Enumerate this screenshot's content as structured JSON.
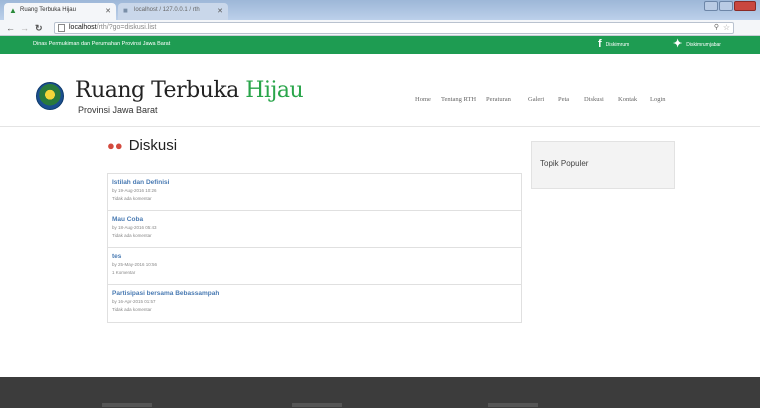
{
  "browser": {
    "active_tab_title": "Ruang Terbuka Hijau",
    "inactive_tab_title": "localhost / 127.0.0.1 / rth",
    "url_host": "localhost",
    "url_path": "/rth/?go=diskusi.list"
  },
  "topbar": {
    "agency": "Dinas Permukiman dan Perumahan Provinsi Jawa Barat",
    "facebook": "Diskimrum",
    "twitter": "Diskimrumjabar"
  },
  "header": {
    "brand_main": "Ruang Terbuka ",
    "brand_accent": "Hijau",
    "brand_sub": "Provinsi Jawa Barat"
  },
  "menu": [
    "Home",
    "Tentang RTH",
    "Peraturan",
    "Galeri",
    "Peta",
    "Diskusi",
    "Kontak",
    "Login"
  ],
  "page": {
    "title": "Diskusi"
  },
  "topics": [
    {
      "title": "Istilah dan Definisi",
      "by": "by 19-Aug-2016 10:26",
      "comments": "Tidak ada komentar"
    },
    {
      "title": "Mau Coba",
      "by": "by 18-Aug-2016 05:43",
      "comments": "Tidak ada komentar"
    },
    {
      "title": "tes",
      "by": "by 25-May-2016 10:56",
      "comments": "1 Komentar"
    },
    {
      "title": "Partisipasi bersama Bebassampah",
      "by": "by 16-Apr-2015 01:57",
      "comments": "Tidak ada komentar"
    }
  ],
  "sidebar": {
    "title": "Topik Populer"
  },
  "colors": {
    "topbar": "#1e9c52",
    "link": "#4a7bb3",
    "footer": "#3c3c3c"
  }
}
